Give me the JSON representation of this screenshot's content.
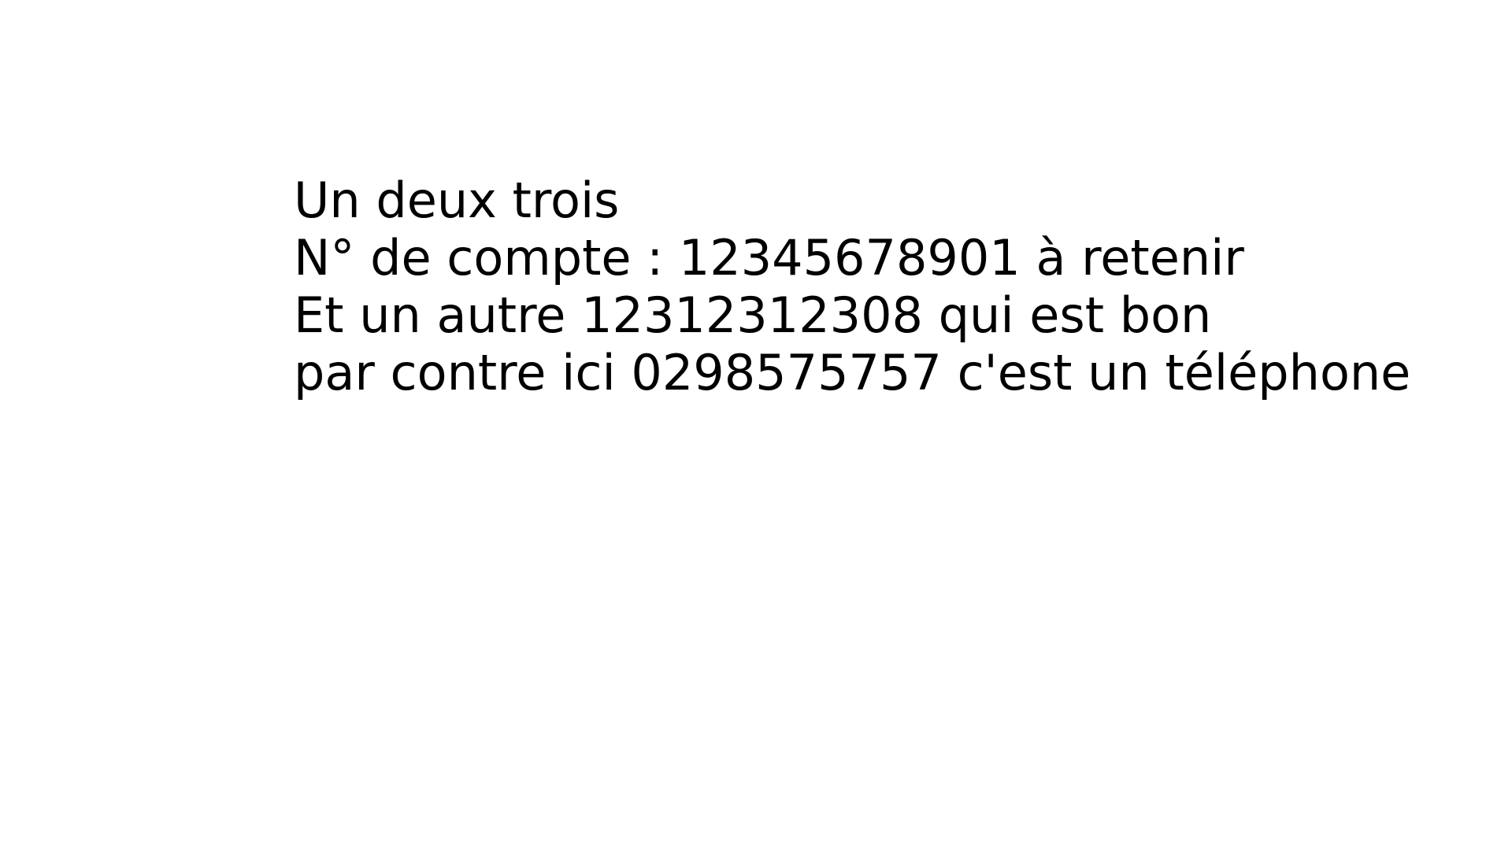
{
  "document": {
    "lines": [
      "Un deux trois",
      "N° de compte : 12345678901 à retenir",
      "Et un autre 12312312308 qui est bon",
      "par contre ici 0298575757 c'est un téléphone"
    ]
  },
  "colors": {
    "background": "#ffffff",
    "text": "#000000"
  }
}
